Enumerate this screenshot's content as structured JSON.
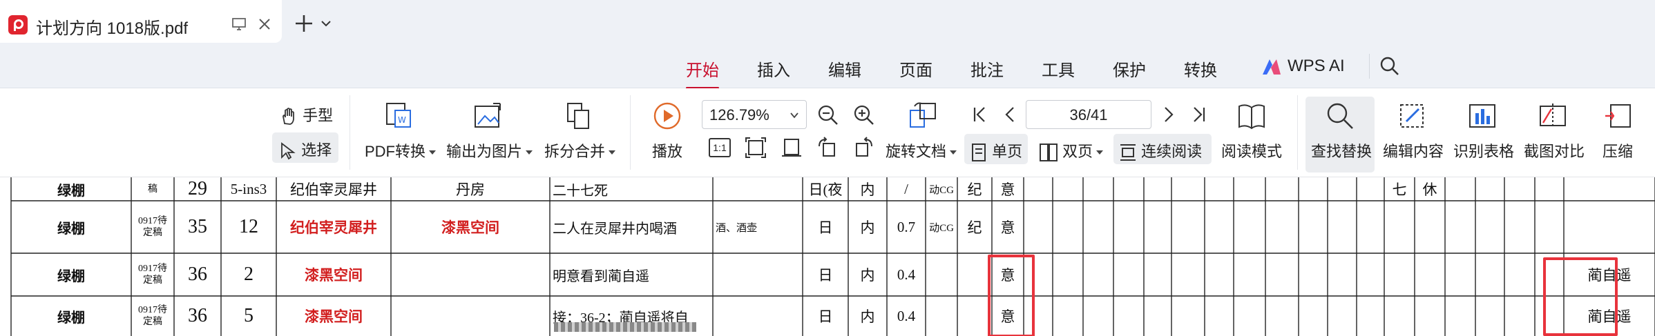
{
  "tab": {
    "title": "计划方向 1018版.pdf",
    "close_icon": "close-icon",
    "monitor_icon": "window-icon"
  },
  "menu": {
    "items": [
      "开始",
      "插入",
      "编辑",
      "页面",
      "批注",
      "工具",
      "保护",
      "转换"
    ],
    "active": "开始",
    "ai_label": "WPS AI",
    "accent": "#c8102e"
  },
  "ribbon": {
    "hand": "手型",
    "select": "选择",
    "pdf_convert": "PDF转换",
    "export_image": "输出为图片",
    "split_merge": "拆分合并",
    "play": "播放",
    "zoom": "126.79%",
    "rotate_doc": "旋转文档",
    "page_display": "36/41",
    "single": "单页",
    "double": "双页",
    "continuous": "连续阅读",
    "read_mode": "阅读模式",
    "find_replace": "查找替换",
    "edit_content": "编辑内容",
    "recognize_table": "识别表格",
    "screenshot_compare": "截图对比",
    "compress": "压缩",
    "actual_size": "1:1"
  },
  "table": {
    "rows": [
      {
        "location": "绿棚",
        "status": [
          "",
          "稿"
        ],
        "episode": "29",
        "scene": "5-ins3",
        "char": "纪伯宰灵犀井",
        "place": "丹房",
        "desc": "二十七死",
        "props": "",
        "time": "日(夜",
        "io": "内",
        "pages": "/",
        "fx": "动CG",
        "c1": "纪",
        "c2": "意",
        "extra1": "七",
        "extra2": "休",
        "role": ""
      },
      {
        "location": "绿棚",
        "status": [
          "0917待",
          "定稿"
        ],
        "episode": "35",
        "scene": "12",
        "char": "纪伯宰灵犀井",
        "place": "漆黑空间",
        "desc": "二人在灵犀井内喝酒",
        "props": "酒、酒壶",
        "time": "日",
        "io": "内",
        "pages": "0.7",
        "fx": "动CG",
        "c1": "纪",
        "c2": "意",
        "extra1": "",
        "extra2": "",
        "role": ""
      },
      {
        "location": "绿棚",
        "status": [
          "0917待",
          "定稿"
        ],
        "episode": "36",
        "scene": "2",
        "char": "漆黑空间",
        "place": "",
        "desc": "明意看到蔺自遥",
        "props": "",
        "time": "日",
        "io": "内",
        "pages": "0.4",
        "fx": "",
        "c1": "",
        "c2": "意",
        "extra1": "",
        "extra2": "",
        "role": "蔺自遥"
      },
      {
        "location": "绿棚",
        "status": [
          "0917待",
          "定稿"
        ],
        "episode": "36",
        "scene": "5",
        "char": "漆黑空间",
        "place": "",
        "desc": "接：36-2；蔺自遥将自",
        "props": "",
        "time": "日",
        "io": "内",
        "pages": "0.4",
        "fx": "",
        "c1": "",
        "c2": "意",
        "extra1": "",
        "extra2": "",
        "role": "蔺自遥"
      }
    ],
    "annotation_color": "#e8333c"
  }
}
